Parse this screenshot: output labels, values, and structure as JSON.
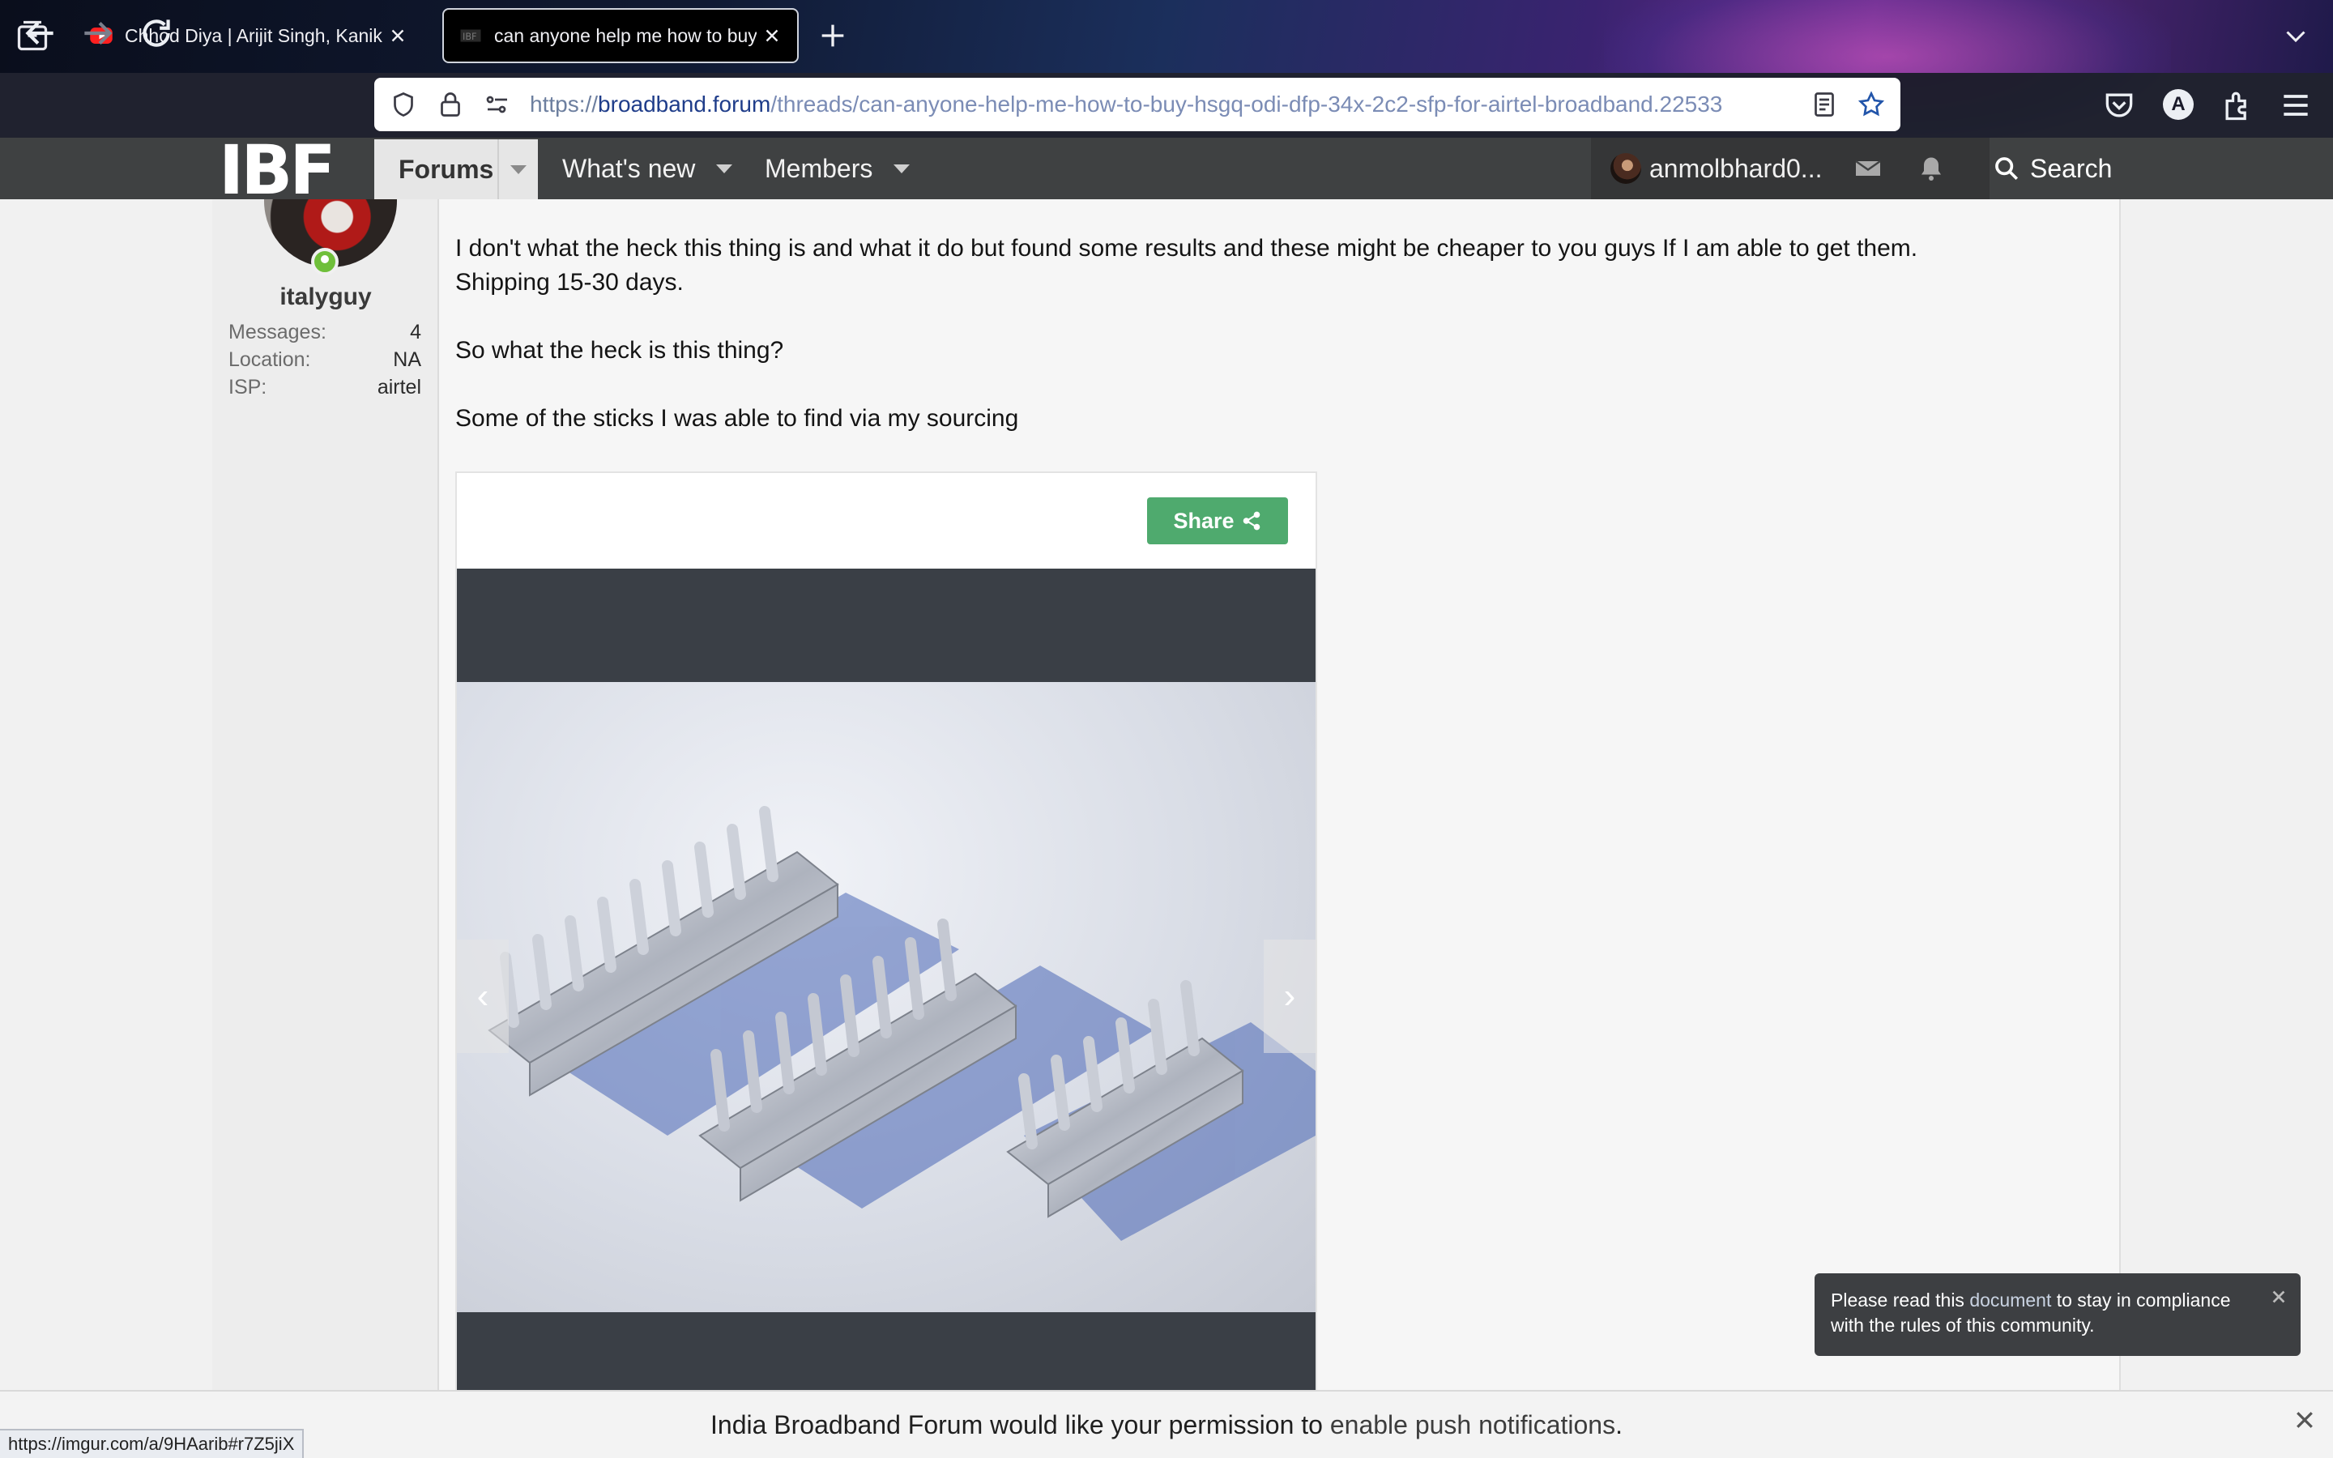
{
  "browser": {
    "tabs": [
      {
        "title": "Chhod Diya | Arijit Singh, Kanika",
        "favicon": "youtube-icon",
        "active": false
      },
      {
        "title": "can anyone help me how to buy",
        "favicon": "ibf-favicon",
        "active": true
      }
    ],
    "url": {
      "prefix": "https://",
      "domain": "broadband.forum",
      "path": "/threads/can-anyone-help-me-how-to-buy-hsgq-odi-dfp-34x-2c2-sfp-for-airtel-broadband.22533"
    },
    "account_initial": "A",
    "status_url": "https://imgur.com/a/9HAarib#r7Z5jiX"
  },
  "forum": {
    "logo": "IBF",
    "nav": {
      "forums": "Forums",
      "whats_new": "What's new",
      "members": "Members",
      "user": "anmolbhard0...",
      "search": "Search"
    }
  },
  "post": {
    "author": "italyguy",
    "stats": [
      {
        "label": "Messages:",
        "value": "4"
      },
      {
        "label": "Location:",
        "value": "NA"
      },
      {
        "label": "ISP:",
        "value": "airtel"
      }
    ],
    "line1": "I don't what the heck this thing is and what it do but found some results and these might be cheaper to you guys If I am able to get them.",
    "line2": "Shipping 15-30 days.",
    "line3": "So what the heck is this thing?",
    "line4": "Some of the sticks I was able to find via my sourcing",
    "embed": {
      "share_label": "Share",
      "prev": "‹",
      "next": "›"
    }
  },
  "toast": {
    "before": "Please read this ",
    "link": "document",
    "after": " to stay in compliance with the rules of this community."
  },
  "push_prompt": {
    "before": "India Broadband Forum would like your permission to ",
    "link": "enable push notifications",
    "after": "."
  },
  "colors": {
    "accent_green": "#4faa6e",
    "forum_bar": "#3f4142",
    "online": "#6fbf3a"
  }
}
